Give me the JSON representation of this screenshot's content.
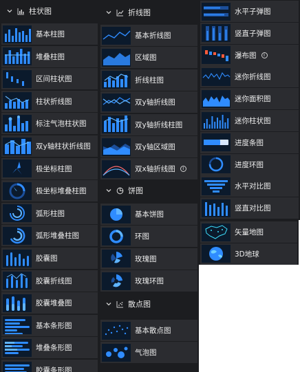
{
  "groups": {
    "bar": {
      "title": "柱状图",
      "items": [
        {
          "label": "基本柱图",
          "icon": "basic-bar-thumbnail"
        },
        {
          "label": "堆叠柱图",
          "icon": "stacked-bar-thumbnail"
        },
        {
          "label": "区间柱状图",
          "icon": "range-bar-thumbnail"
        },
        {
          "label": "柱状折线图",
          "icon": "bar-line-thumbnail"
        },
        {
          "label": "标注气泡柱状图",
          "icon": "bubble-bar-thumbnail"
        },
        {
          "label": "双y轴柱状折线图",
          "icon": "dual-axis-bar-line-thumbnail"
        },
        {
          "label": "极坐标柱图",
          "icon": "polar-bar-thumbnail"
        },
        {
          "label": "极坐标堆叠柱图",
          "icon": "polar-stacked-bar-thumbnail"
        },
        {
          "label": "弧形柱图",
          "icon": "arc-bar-thumbnail"
        },
        {
          "label": "弧形堆叠柱图",
          "icon": "arc-stacked-bar-thumbnail"
        },
        {
          "label": "胶囊图",
          "icon": "capsule-thumbnail"
        },
        {
          "label": "胶囊折线图",
          "icon": "capsule-line-thumbnail"
        },
        {
          "label": "胶囊堆叠图",
          "icon": "capsule-stacked-thumbnail"
        },
        {
          "label": "基本条形图",
          "icon": "basic-hbar-thumbnail"
        },
        {
          "label": "堆叠条形图",
          "icon": "stacked-hbar-thumbnail"
        },
        {
          "label": "胶囊条形图",
          "icon": "capsule-hbar-thumbnail"
        }
      ]
    },
    "line": {
      "title": "折线图",
      "items": [
        {
          "label": "基本折线图",
          "icon": "basic-line-thumbnail"
        },
        {
          "label": "区域图",
          "icon": "area-thumbnail"
        },
        {
          "label": "折线柱图",
          "icon": "line-bar-thumbnail"
        },
        {
          "label": "双y轴折线图",
          "icon": "dual-y-line-thumbnail"
        },
        {
          "label": "双y轴折线柱图",
          "icon": "dual-y-line-bar-thumbnail"
        },
        {
          "label": "双y轴区域图",
          "icon": "dual-y-area-thumbnail"
        },
        {
          "label": "双x轴折线图",
          "icon": "dual-x-line-thumbnail",
          "info": "i"
        }
      ]
    },
    "pie": {
      "title": "饼图",
      "items": [
        {
          "label": "基本饼图",
          "icon": "basic-pie-thumbnail"
        },
        {
          "label": "环图",
          "icon": "ring-thumbnail"
        },
        {
          "label": "玫瑰图",
          "icon": "rose-thumbnail"
        },
        {
          "label": "玫瑰环图",
          "icon": "rose-ring-thumbnail"
        }
      ]
    },
    "scatter": {
      "title": "散点图",
      "items": [
        {
          "label": "基本散点图",
          "icon": "basic-scatter-thumbnail"
        },
        {
          "label": "气泡图",
          "icon": "bubble-thumbnail"
        }
      ]
    },
    "misc": {
      "items": [
        {
          "label": "水平子弹图",
          "icon": "horizontal-bullet-thumbnail"
        },
        {
          "label": "竖直子弹图",
          "icon": "vertical-bullet-thumbnail"
        },
        {
          "label": "瀑布图",
          "icon": "waterfall-thumbnail",
          "info": "i"
        },
        {
          "label": "迷你折线图",
          "icon": "mini-line-thumbnail"
        },
        {
          "label": "迷你面积图",
          "icon": "mini-area-thumbnail"
        },
        {
          "label": "迷你柱状图",
          "icon": "mini-bar-thumbnail"
        },
        {
          "label": "进度条图",
          "icon": "progress-bar-thumbnail"
        },
        {
          "label": "进度环图",
          "icon": "progress-ring-thumbnail"
        },
        {
          "label": "水平对比图",
          "icon": "horizontal-compare-thumbnail"
        },
        {
          "label": "竖直对比图",
          "icon": "vertical-compare-thumbnail"
        }
      ]
    },
    "map": {
      "items": [
        {
          "label": "矢量地图",
          "icon": "vector-map-thumbnail"
        },
        {
          "label": "3D地球",
          "icon": "globe-3d-thumbnail"
        }
      ]
    }
  },
  "colors": {
    "panel": "#1c1d20",
    "item": "#2b2c30",
    "thumb_bg": "#0b1a2c",
    "accent": "#2f8cff",
    "accent_light": "#5fb4ff",
    "text": "#ececec"
  }
}
